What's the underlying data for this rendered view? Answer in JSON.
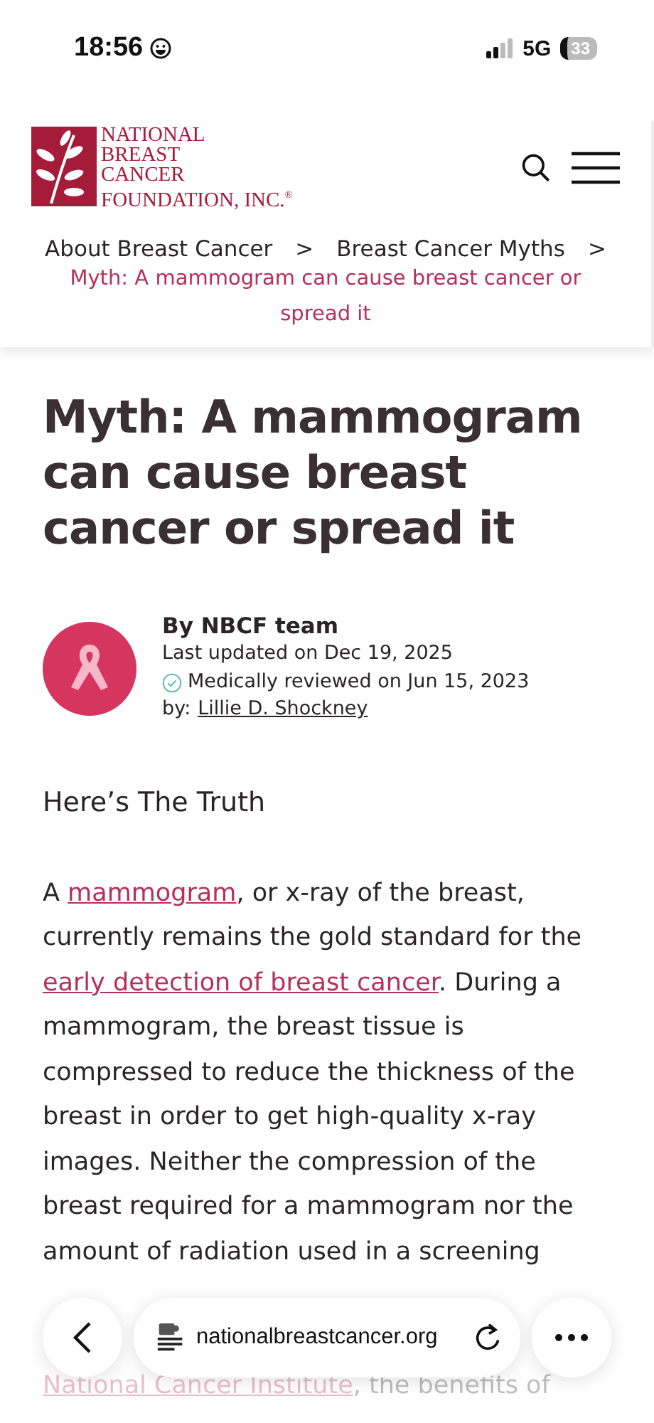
{
  "status_bar": {
    "time": "18:56",
    "network": "5G",
    "battery": "33"
  },
  "header": {
    "logo_lines": [
      "NATIONAL",
      "BREAST",
      "CANCER",
      "FOUNDATION, INC."
    ],
    "logo_mark": "®",
    "breadcrumbs": [
      "About Breast Cancer",
      "Breast Cancer Myths"
    ],
    "separator": ">",
    "current": "Myth: A mammogram can cause breast cancer or spread it"
  },
  "article": {
    "title": "Myth: A mammogram can cause breast cancer or spread it",
    "author": {
      "byline": "By NBCF team",
      "updated": "Last updated on Dec 19, 2025",
      "reviewed": "Medically reviewed on Jun 15, 2023",
      "reviewer_prefix": "by:",
      "reviewer": "Lillie D. Shockney"
    },
    "heading": "Here’s The Truth",
    "paragraph": [
      {
        "kind": "text",
        "text": "A "
      },
      {
        "kind": "link",
        "text": "mammogram"
      },
      {
        "kind": "text",
        "text": ", or x-ray of the breast, currently remains the gold standard for the "
      },
      {
        "kind": "link",
        "text": "early detection of breast cancer"
      },
      {
        "kind": "text",
        "text": ". During a mammogram, the breast tissue is compressed to reduce the thickness of the breast in order to get high-quality x-ray images. Neither the compression of the breast required for a mammogram nor the amount of radiation used in a screening"
      }
    ],
    "faded_line": [
      {
        "kind": "link",
        "text": "National Cancer Institute"
      },
      {
        "kind": "text",
        "text": ", the benefits of"
      }
    ]
  },
  "browser_bar": {
    "url": "nationalbreastcancer.org"
  }
}
